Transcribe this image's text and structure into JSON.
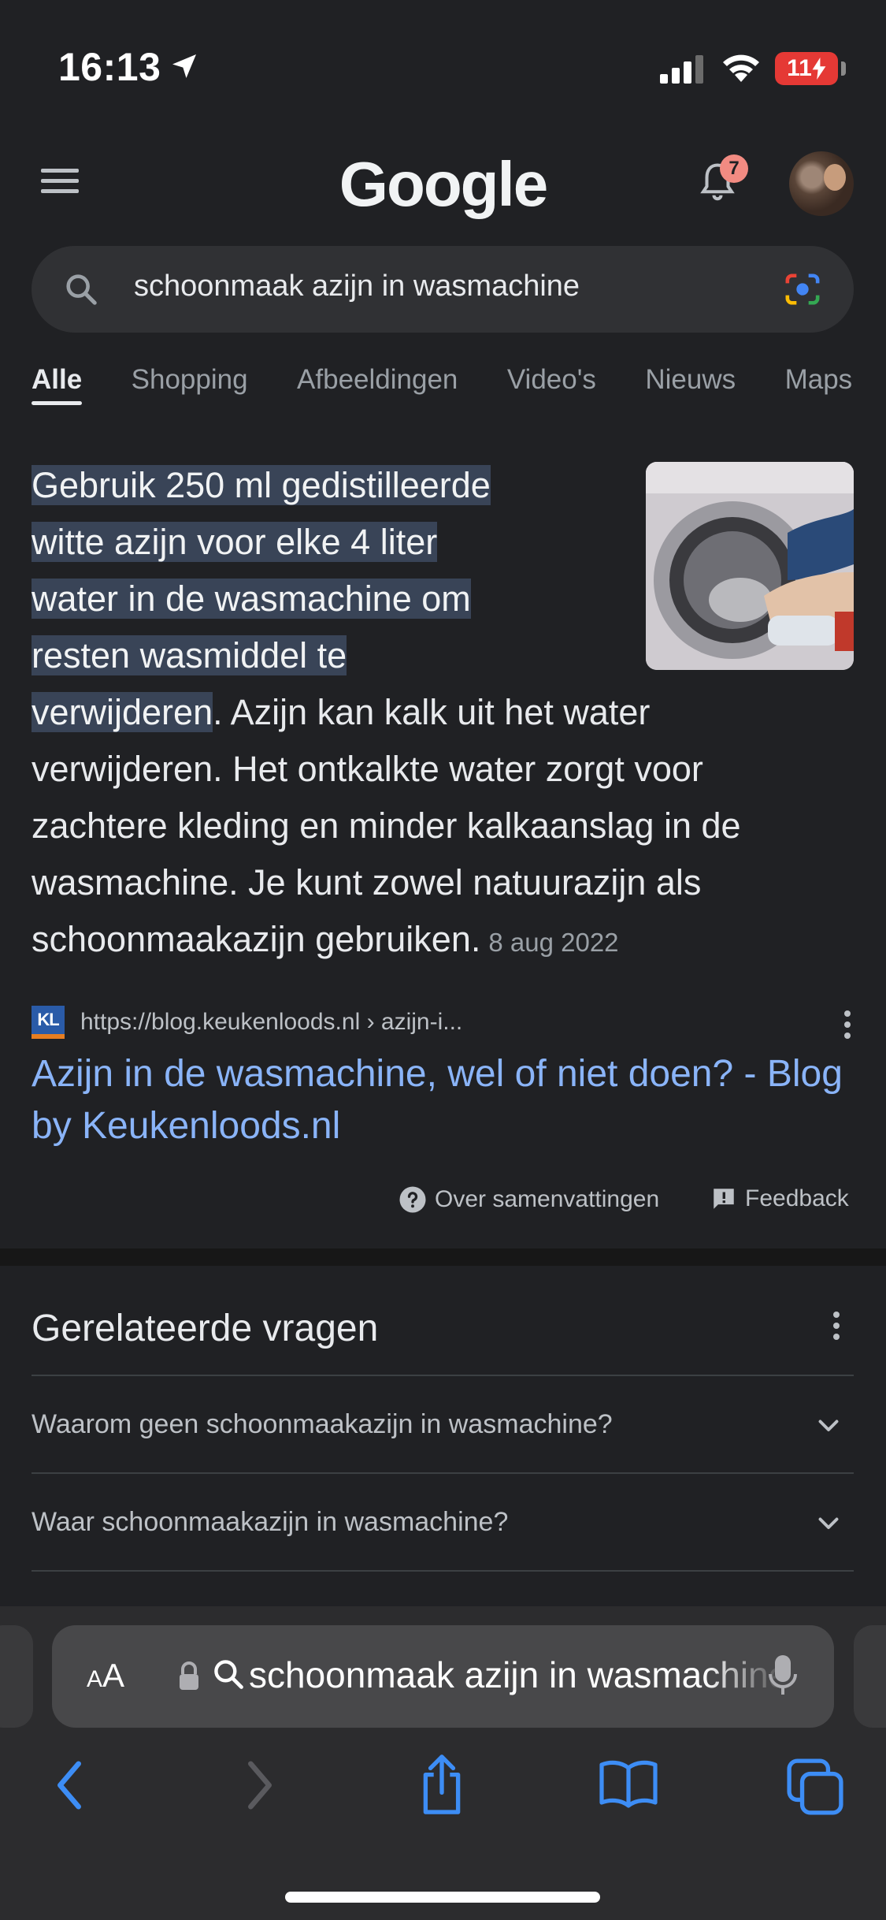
{
  "status_bar": {
    "time": "16:13",
    "battery": "11"
  },
  "header": {
    "logo": "Google",
    "notification_count": "7"
  },
  "search": {
    "query": "schoonmaak azijn in wasmachine"
  },
  "tabs": [
    {
      "label": "Alle",
      "active": true
    },
    {
      "label": "Shopping"
    },
    {
      "label": "Afbeeldingen"
    },
    {
      "label": "Video's"
    },
    {
      "label": "Nieuws"
    },
    {
      "label": "Maps"
    }
  ],
  "snippet": {
    "highlight_lines": [
      "Gebruik 250 ml gedistilleerde",
      "witte azijn voor elke 4 liter",
      "water in de wasmachine om",
      "resten wasmiddel te",
      "verwijderen"
    ],
    "rest_first": ". Azijn kan kalk uit het water",
    "rest_lines": [
      "verwijderen. Het ontkalkte water zorgt voor",
      "zachtere kleding en minder kalkaanslag in de",
      "wasmachine. Je kunt zowel natuurazijn als",
      "schoonmaakazijn gebruiken."
    ],
    "date": "8 aug 2022",
    "source_logo": "KL",
    "source_url": "https://blog.keukenloods.nl › azijn-i...",
    "title": "Azijn in de wasmachine, wel of niet doen? - Blog by Keukenloods.nl",
    "about_label": "Over samenvattingen",
    "feedback_label": "Feedback"
  },
  "related": {
    "title": "Gerelateerde vragen",
    "questions": [
      "Waarom geen schoonmaakazijn in wasmachine?",
      "Waar schoonmaakazijn in wasmachine?"
    ]
  },
  "safari": {
    "aa_big": "A",
    "aa_small": "A",
    "address_text": "schoonmaak azijn in wasmachine"
  },
  "colors": {
    "background": "#202124",
    "link": "#8ab4f8",
    "highlight": "#394457",
    "battery_low": "#e53935",
    "ios_blue": "#3d8df5"
  }
}
